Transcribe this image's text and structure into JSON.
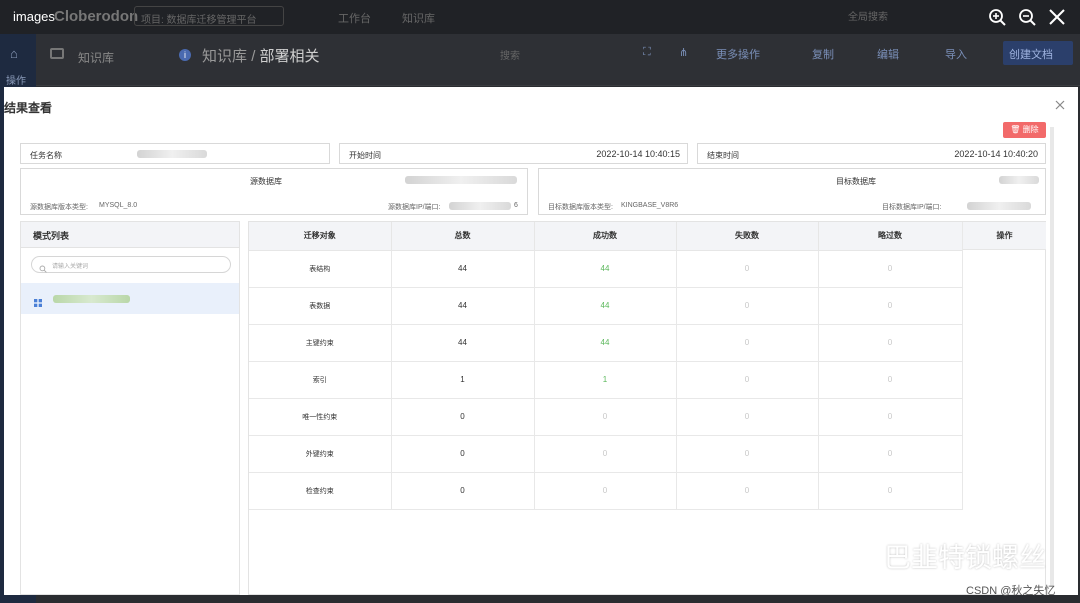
{
  "viewer": {
    "title": "images"
  },
  "background": {
    "logo": "Cloberodon",
    "project_select": "项目: 数据库迁移管理平台",
    "nav": [
      "工作台",
      "知识库"
    ],
    "search": "全局搜索",
    "side_label": "操作",
    "kb_label": "知识库",
    "breadcrumb_root": "知识库",
    "breadcrumb_sep": "/",
    "breadcrumb_current": "部署相关",
    "search_placeholder": "搜索",
    "tools": [
      "更多操作",
      "复制",
      "编辑",
      "导入"
    ],
    "create_button": "创建文档"
  },
  "dialog": {
    "title": "结果查看",
    "delete_button": "删除",
    "task_name_label": "任务名称",
    "start_time_label": "开始时间",
    "start_time": "2022-10-14 10:40:15",
    "end_time_label": "结束时间",
    "end_time": "2022-10-14 10:40:20",
    "source": {
      "title": "源数据库",
      "type_label": "源数据库版本类型:",
      "type_value": "MYSQL_8.0",
      "ip_label": "源数据库IP/端口:",
      "ip_suffix": "6"
    },
    "target": {
      "title": "目标数据库",
      "type_label": "目标数据库版本类型:",
      "type_value": "KINGBASE_V8R6",
      "ip_label": "目标数据库IP/端口:"
    },
    "schema_list": {
      "title": "模式列表",
      "search_placeholder": "请输入关键词"
    },
    "table": {
      "headers": [
        "迁移对象",
        "总数",
        "成功数",
        "失败数",
        "略过数",
        "操作"
      ],
      "rows": [
        {
          "name": "表结构",
          "total": "44",
          "success": "44",
          "failed": "0",
          "skipped": "0"
        },
        {
          "name": "表数据",
          "total": "44",
          "success": "44",
          "failed": "0",
          "skipped": "0"
        },
        {
          "name": "主键约束",
          "total": "44",
          "success": "44",
          "failed": "0",
          "skipped": "0"
        },
        {
          "name": "索引",
          "total": "1",
          "success": "1",
          "failed": "0",
          "skipped": "0"
        },
        {
          "name": "唯一性约束",
          "total": "0",
          "success": "0",
          "failed": "0",
          "skipped": "0"
        },
        {
          "name": "外键约束",
          "total": "0",
          "success": "0",
          "failed": "0",
          "skipped": "0"
        },
        {
          "name": "检查约束",
          "total": "0",
          "success": "0",
          "failed": "0",
          "skipped": "0"
        }
      ]
    }
  },
  "watermark": {
    "text": "巴韭特锁螺丝",
    "credit": "CSDN @秋之失忆"
  },
  "colors": {
    "success": "#5cb85c",
    "delete": "#f26a6a",
    "selected_row": "#e9f0fb"
  }
}
